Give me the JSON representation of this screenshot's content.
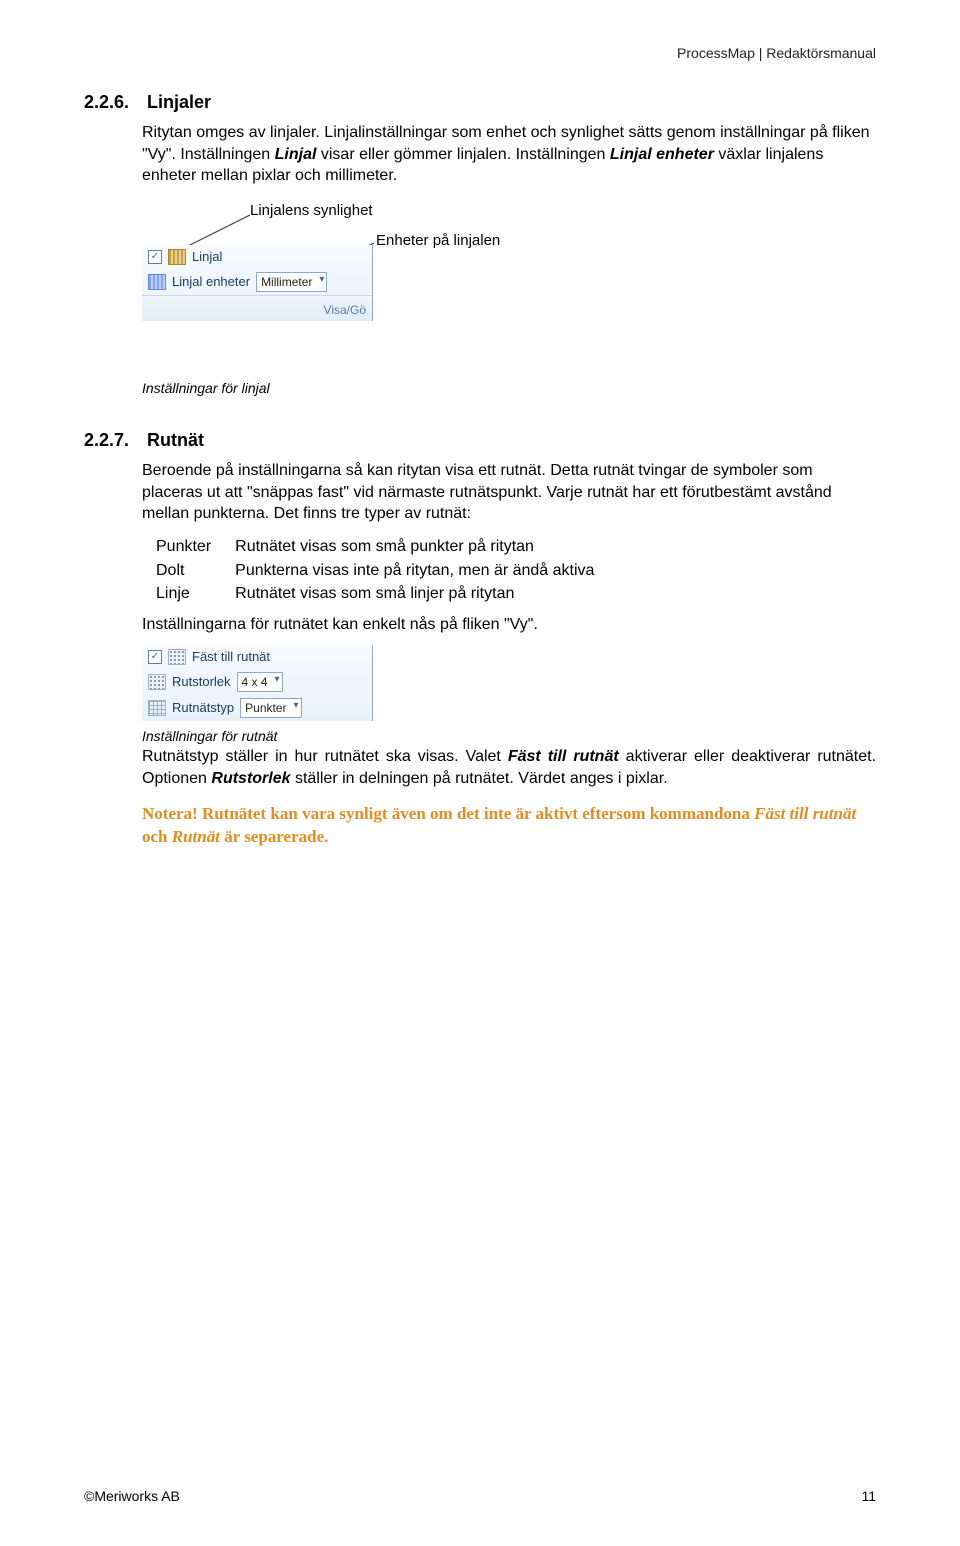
{
  "header": "ProcessMap | Redaktörsmanual",
  "sec1": {
    "num": "2.2.6.",
    "title": "Linjaler",
    "p1_a": "Ritytan omges av linjaler. Linjalinställningar som enhet och synlighet sätts genom inställningar på fliken \"Vy\". Inställningen ",
    "p1_b": " visar eller gömmer linjalen. Inställningen ",
    "p1_c": " växlar linjalens enheter mellan pixlar och millimeter.",
    "b1": "Linjal",
    "b2": "Linjal enheter",
    "callout1": "Linjalens synlighet",
    "callout2": "Enheter på linjalen",
    "panel": {
      "row1": "Linjal",
      "row2": "Linjal enheter",
      "dd": "Millimeter",
      "footer": "Visa/Gö"
    },
    "figcap": "Inställningar för linjal"
  },
  "sec2": {
    "num": "2.2.7.",
    "title": "Rutnät",
    "p1": "Beroende på inställningarna så kan ritytan visa ett rutnät. Detta rutnät tvingar de symboler som placeras ut att \"snäppas fast\" vid närmaste rutnätspunkt. Varje rutnät har ett förutbestämt avstånd mellan punkterna. Det finns tre typer av rutnät:",
    "defs": [
      {
        "k": "Punkter",
        "v": "Rutnätet visas som små punkter på ritytan"
      },
      {
        "k": "Dolt",
        "v": "Punkterna visas inte på ritytan, men är ändå aktiva"
      },
      {
        "k": "Linje",
        "v": "Rutnätet visas som små linjer på ritytan"
      }
    ],
    "p2": "Inställningarna för rutnätet kan enkelt nås på fliken \"Vy\".",
    "panel": {
      "row1": "Fäst till rutnät",
      "row2": "Rutstorlek",
      "dd2": "4 x 4",
      "row3": "Rutnätstyp",
      "dd3": "Punkter"
    },
    "figcap": "Inställningar för rutnät",
    "p3_a": "Rutnätstyp ställer in hur rutnätet ska visas. Valet ",
    "p3_b": " aktiverar eller deaktiverar rutnätet. Optionen ",
    "p3_c": " ställer in delningen på rutnätet. Värdet anges i pixlar.",
    "p3_bi1": "Fäst till rutnät",
    "p3_bi2": "Rutstorlek",
    "note_a": "Notera!",
    "note_b": " Rutnätet kan vara synligt även om det inte är aktivt eftersom kommandona ",
    "note_c": " och ",
    "note_d": " är separerade.",
    "note_i1": "Fäst till rutnät",
    "note_i2": "Rutnät"
  },
  "footer": {
    "left": "©Meriworks AB",
    "right": "11"
  }
}
